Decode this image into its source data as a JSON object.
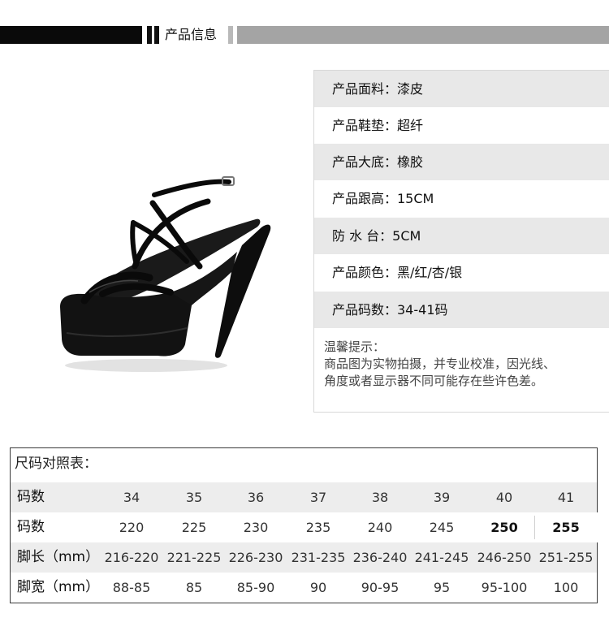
{
  "header": {
    "title": "产品信息"
  },
  "product": {
    "rows": [
      "产品面料：漆皮",
      "产品鞋垫：超纤",
      "产品大底：橡胶",
      "产品跟高：15CM",
      "防 水 台：5CM",
      "产品颜色：黑/红/杏/银",
      "产品码数：34-41码"
    ],
    "tip_title": "温馨提示：",
    "tip_line1": "商品图为实物拍摄，并专业校准，因光线、",
    "tip_line2": "角度或者显示器不同可能存在些许色差。"
  },
  "size_table": {
    "title": "尺码对照表：",
    "rows": [
      {
        "label": "码数",
        "cells": [
          "34",
          "35",
          "36",
          "37",
          "38",
          "39",
          "40",
          "41"
        ]
      },
      {
        "label": "码数",
        "cells": [
          "220",
          "225",
          "230",
          "235",
          "240",
          "245",
          "250",
          "255"
        ]
      },
      {
        "label": "脚长（mm）",
        "cells": [
          "216-220",
          "221-225",
          "226-230",
          "231-235",
          "236-240",
          "241-245",
          "246-250",
          "251-255"
        ]
      },
      {
        "label": "脚宽（mm）",
        "cells": [
          "88-85",
          "85",
          "85-90",
          "90",
          "90-95",
          "95",
          "95-100",
          "100"
        ]
      }
    ]
  },
  "shoe_image": {
    "icon": "platform-high-heel-sandal-image",
    "color": "#111111"
  }
}
